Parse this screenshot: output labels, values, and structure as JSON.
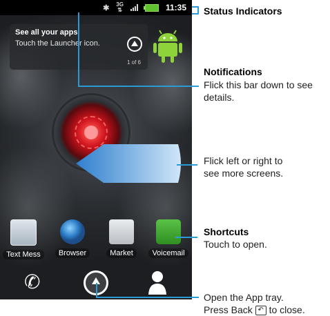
{
  "status_bar": {
    "time": "11:35",
    "network": "3G",
    "bluetooth_icon": "bluetooth-icon"
  },
  "notification": {
    "title": "See all your apps",
    "subtitle": "Touch the Launcher icon.",
    "page": "1 of 6"
  },
  "apps": [
    {
      "label": "Text Mess",
      "icon": "text-messaging-icon"
    },
    {
      "label": "Browser",
      "icon": "browser-globe-icon"
    },
    {
      "label": "Market",
      "icon": "market-bag-icon"
    },
    {
      "label": "Voicemail",
      "icon": "voicemail-icon"
    }
  ],
  "dock": {
    "phone_icon": "phone-icon",
    "tray_icon": "app-tray-icon",
    "contacts_icon": "contacts-icon"
  },
  "callouts": {
    "status_indicators": "Status Indicators",
    "notifications_title": "Notifications",
    "notifications_body_1": "Flick this bar down to see",
    "notifications_body_2": "details.",
    "screens_1": "Flick left or right to",
    "screens_2": "see more screens.",
    "shortcuts_title": "Shortcuts",
    "shortcuts_body": "Touch to open.",
    "app_tray_1": "Open the App tray.",
    "app_tray_2a": "Press Back",
    "app_tray_2b": "to close."
  },
  "colors": {
    "callout_line": "#2a9bd5",
    "battery": "#5ec12f",
    "swipe_arrow": "#4aa3e0"
  }
}
